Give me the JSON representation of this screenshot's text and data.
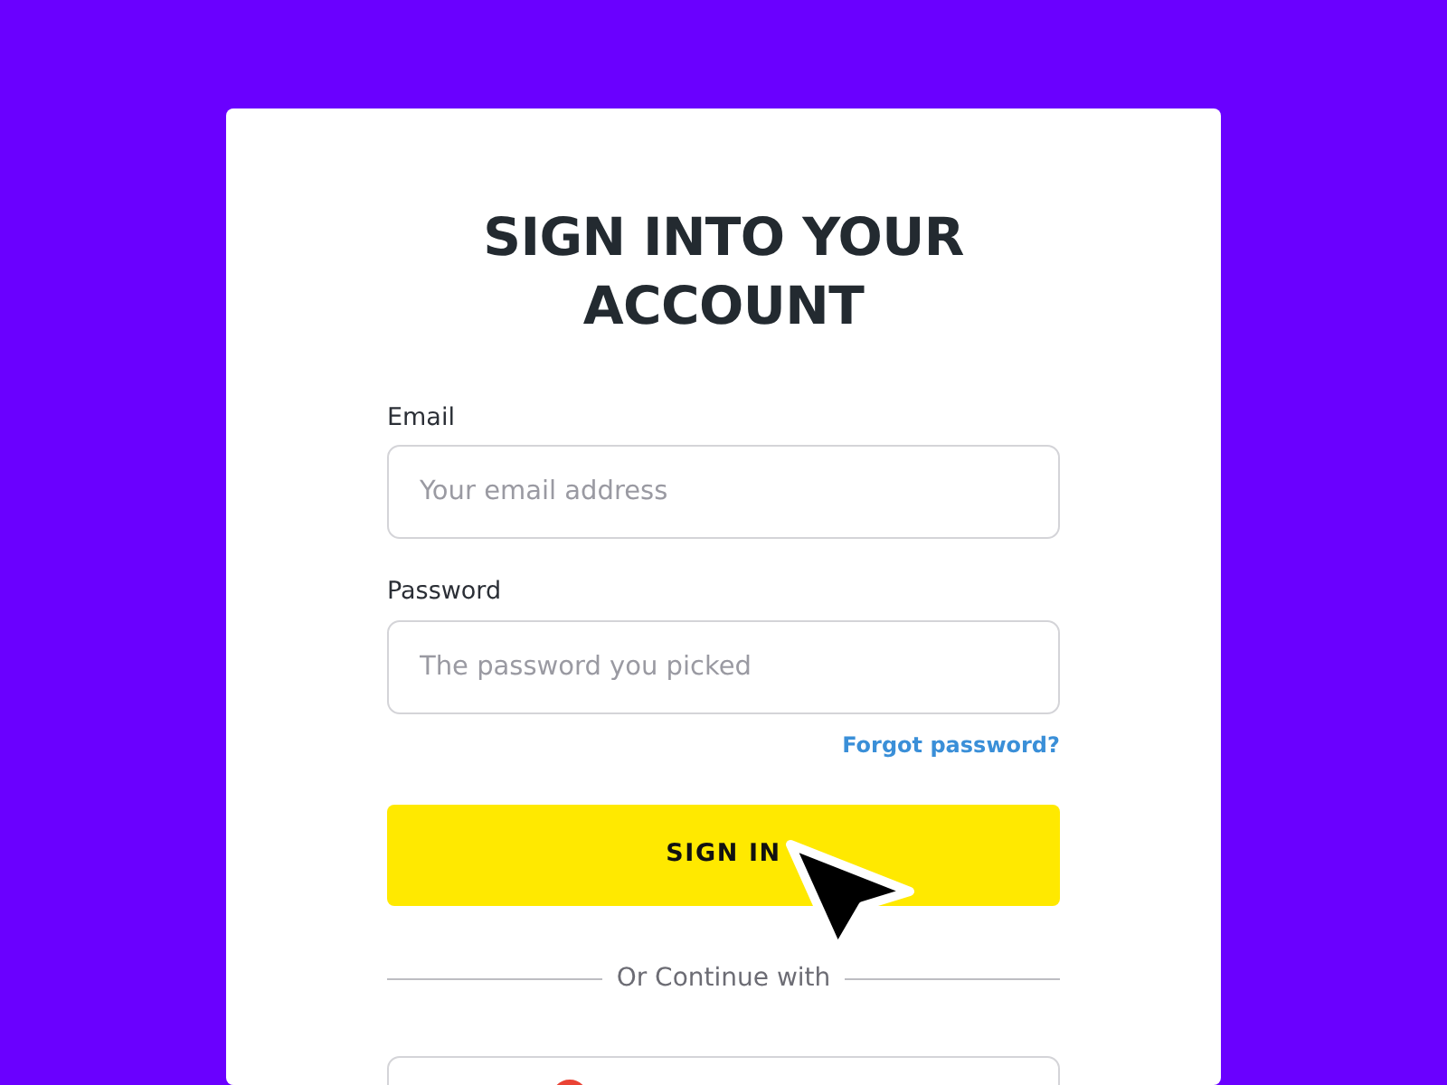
{
  "heading": "SIGN INTO YOUR ACCOUNT",
  "fields": [
    {
      "label": "Email",
      "placeholder": "Your email address"
    },
    {
      "label": "Password",
      "placeholder": "The password you picked"
    }
  ],
  "forgot_link": "Forgot password?",
  "submit_button": "SIGN IN",
  "divider_text": "Or Continue with"
}
